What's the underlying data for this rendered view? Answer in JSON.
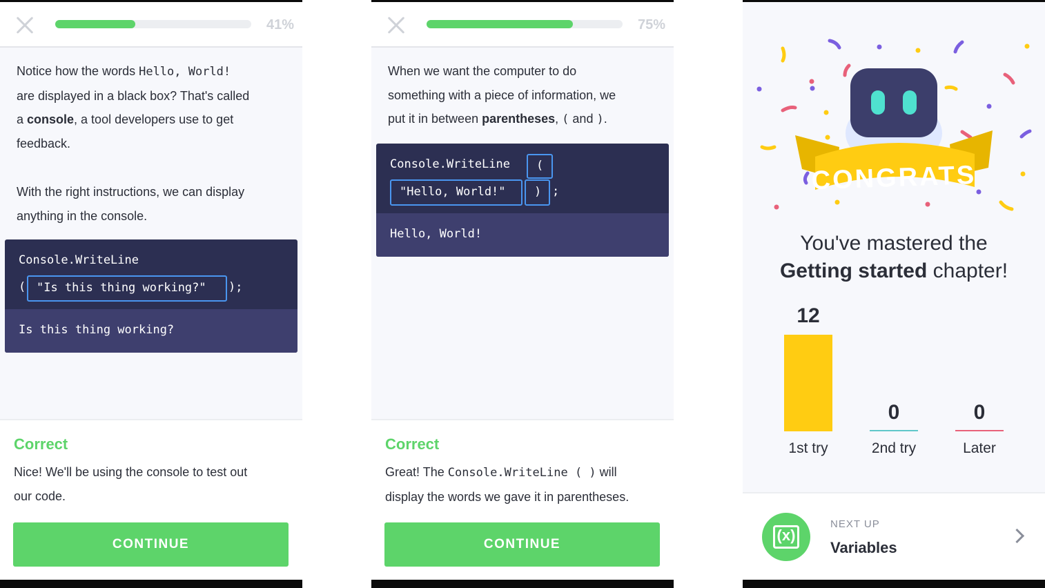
{
  "lesson1": {
    "progress_label": "41%",
    "progress": 0.41,
    "p1_a": "Notice how the words ",
    "p1_code": "Hello, World!",
    "p1_b": "are displayed in a black box? That's called",
    "p1_c": "a ",
    "p1_bold": "console",
    "p1_d": ", a tool developers use to get",
    "p1_e": "feedback.",
    "p2_a": "With the right instructions, we can display",
    "p2_b": "anything in the console.",
    "code_line1": "Console.WriteLine",
    "code_open": "(",
    "code_string": "\"Is this thing working?\"",
    "code_close": ");",
    "output": "Is this thing working?",
    "feedback_title": "Correct",
    "feedback_l1": "Nice! We'll be using the console to test out",
    "feedback_l2": "our code.",
    "continue_label": "CONTINUE"
  },
  "lesson2": {
    "progress_label": "75%",
    "progress": 0.75,
    "t1": "When we want the computer to do",
    "t2": "something with a piece of information, we",
    "t3_a": "put it in between ",
    "t3_bold": "parentheses",
    "t3_b": ", ",
    "t3_open": "(",
    "t3_and": " and ",
    "t3_close": ")",
    "t3_end": ".",
    "code_fn": "Console.WriteLine",
    "code_open": "(",
    "code_string": "\"Hello, World!\"",
    "code_close": ")",
    "code_semi": ";",
    "output": "Hello, World!",
    "feedback_title": "Correct",
    "fb_a": "Great! The ",
    "fb_code": "Console.WriteLine ( )",
    "fb_b": " will",
    "fb_l2": "display the words we gave it in parentheses.",
    "continue_label": "CONTINUE"
  },
  "congrats": {
    "banner": "CONGRATS",
    "line1": "You've mastered the",
    "chapter": "Getting started",
    "line2_end": " chapter!",
    "stats": [
      {
        "value": "12",
        "label": "1st try"
      },
      {
        "value": "0",
        "label": "2nd try"
      },
      {
        "value": "0",
        "label": "Later"
      }
    ],
    "next_label": "NEXT UP",
    "next_title": "Variables",
    "next_icon_text": "(x)",
    "colors": {
      "first": "#ffcc12",
      "second": "#5fc7c9",
      "later": "#e8617a",
      "green": "#5dd46a",
      "robot": "#3c3e6b"
    }
  }
}
